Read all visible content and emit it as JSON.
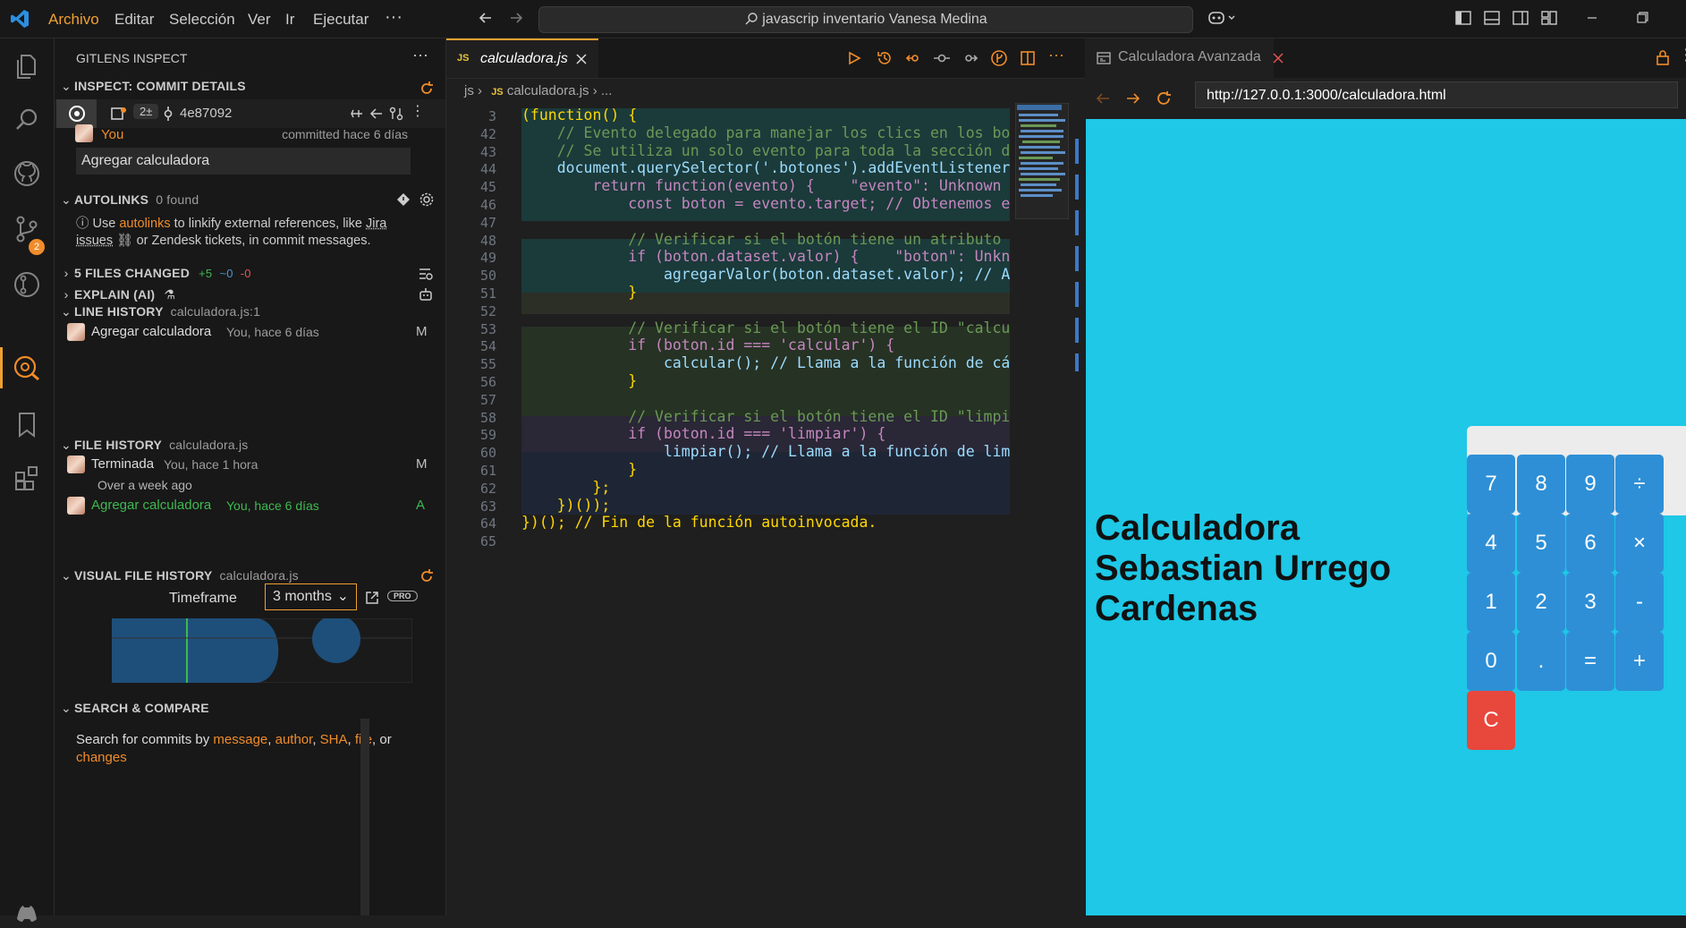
{
  "menu": {
    "items": [
      "Archivo",
      "Editar",
      "Selección",
      "Ver",
      "Ir",
      "Ejecutar"
    ],
    "more": "···"
  },
  "command_center": {
    "text": "javascrip inventario Vanesa Medina"
  },
  "activity_badge": "2",
  "sidebar": {
    "title": "GITLENS INSPECT",
    "dots": "···",
    "inspect_header": "INSPECT: COMMIT DETAILS",
    "commit_badge": "2±",
    "commit_sha": "4e87092",
    "author": "You",
    "committed": "committed hace 6 días",
    "message": "Agregar calculadora",
    "autolinks": {
      "title": "AUTOLINKS",
      "sub": "0 found",
      "t1": "Use",
      "link1": "autolinks",
      "t2": "to linkify external references, like",
      "link2": "Jira issues",
      "t3": "or Zendesk tickets, in commit messages."
    },
    "files_changed": {
      "title": "5 FILES CHANGED",
      "plus": "+5",
      "tilde": "~0",
      "minus": "-0"
    },
    "explain": {
      "title": "EXPLAIN (AI)"
    },
    "line_history": {
      "title": "LINE HISTORY",
      "sub": "calculadora.js:1",
      "item_label": "Agregar calculadora",
      "item_meta": "You, hace 6 días",
      "item_status": "M"
    },
    "file_history": {
      "title": "FILE HISTORY",
      "sub": "calculadora.js",
      "items": [
        {
          "label": "Terminada",
          "meta": "You, hace 1 hora",
          "status": "M"
        },
        {
          "label": "Agregar calculadora",
          "meta": "You, hace 6 días",
          "status": "A"
        }
      ],
      "group": "Over a week ago"
    },
    "visual": {
      "title": "VISUAL FILE HISTORY",
      "sub": "calculadora.js",
      "timeframe_label": "Timeframe",
      "timeframe_value": "3 months",
      "pro": "PRO"
    },
    "search": {
      "title": "SEARCH & COMPARE",
      "t1": "Search for commits by",
      "links": [
        "message",
        "author",
        "SHA",
        "file"
      ],
      "or": "or",
      "last": "changes"
    }
  },
  "editor": {
    "tab_label": "calculadora.js",
    "tab_lang": "JS",
    "breadcrumb": {
      "folder": "js",
      "file": "calculadora.js",
      "tail": "..."
    },
    "lines": [
      {
        "n": "3",
        "t": "(function() {"
      },
      {
        "n": "42",
        "t": "    // Evento delegado para manejar los clics en los boto"
      },
      {
        "n": "43",
        "t": "    // Se utiliza un solo evento para toda la sección de"
      },
      {
        "n": "44",
        "t": "    document.querySelector('.botones').addEventListener("
      },
      {
        "n": "45",
        "t": "        return function(evento) {    \"evento\": Unknown wo"
      },
      {
        "n": "46",
        "t": "            const boton = evento.target; // Obtenemos el"
      },
      {
        "n": "47",
        "t": ""
      },
      {
        "n": "48",
        "t": "            // Verificar si el botón tiene un atributo da"
      },
      {
        "n": "49",
        "t": "            if (boton.dataset.valor) {    \"boton\": Unknow"
      },
      {
        "n": "50",
        "t": "                agregarValor(boton.dataset.valor); // Agr"
      },
      {
        "n": "51",
        "t": "            }"
      },
      {
        "n": "52",
        "t": ""
      },
      {
        "n": "53",
        "t": "            // Verificar si el botón tiene el ID \"calcula"
      },
      {
        "n": "54",
        "t": "            if (boton.id === 'calcular') {"
      },
      {
        "n": "55",
        "t": "                calcular(); // Llama a la función de cálc"
      },
      {
        "n": "56",
        "t": "            }"
      },
      {
        "n": "57",
        "t": ""
      },
      {
        "n": "58",
        "t": "            // Verificar si el botón tiene el ID \"limpiar"
      },
      {
        "n": "59",
        "t": "            if (boton.id === 'limpiar') {"
      },
      {
        "n": "60",
        "t": "                limpiar(); // Llama a la función de limpi"
      },
      {
        "n": "61",
        "t": "            }"
      },
      {
        "n": "62",
        "t": "        };"
      },
      {
        "n": "63",
        "t": "    })());"
      },
      {
        "n": "64",
        "t": "})(); // Fin de la función autoinvocada."
      },
      {
        "n": "65",
        "t": ""
      }
    ]
  },
  "browser": {
    "tab_title": "Calculadora Avanzada",
    "url": "http://127.0.0.1:3000/calculadora.html",
    "page_title": "Calculadora Sebastian Urrego Cardenas",
    "keys": [
      "7",
      "8",
      "9",
      "÷",
      "4",
      "5",
      "6",
      "×",
      "1",
      "2",
      "3",
      "-",
      "0",
      ".",
      "=",
      "+",
      "C"
    ]
  },
  "colors": {
    "accent": "#f0a030",
    "page_bg": "#1ec8e6",
    "key_blue": "#2e8fd6",
    "key_clear": "#e8473c"
  }
}
